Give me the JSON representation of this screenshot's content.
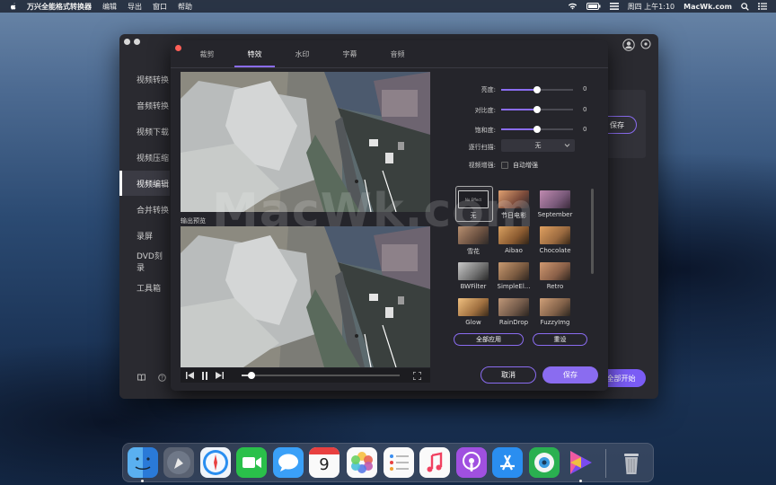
{
  "menubar": {
    "app_name": "万兴全能格式转换器",
    "menus": [
      "编辑",
      "导出",
      "窗口",
      "帮助"
    ],
    "clock": "周四 上午1:10",
    "site": "MacWk.com"
  },
  "sidebar": {
    "items": [
      {
        "label": "视频转换"
      },
      {
        "label": "音频转换"
      },
      {
        "label": "视频下载"
      },
      {
        "label": "视频压缩"
      },
      {
        "label": "视频编辑"
      },
      {
        "label": "合并转换"
      },
      {
        "label": "录屏"
      },
      {
        "label": "DVD刻录"
      },
      {
        "label": "工具箱"
      }
    ]
  },
  "background_window": {
    "save_label": "保存",
    "start_all_label": "全部开始"
  },
  "dialog": {
    "tabs": [
      "裁剪",
      "特效",
      "水印",
      "字幕",
      "音频"
    ],
    "preview_label": "输出预览",
    "adjust": {
      "brightness_label": "亮度:",
      "brightness_value": "0",
      "contrast_label": "对比度:",
      "contrast_value": "0",
      "saturation_label": "饱和度:",
      "saturation_value": "0",
      "deinterlace_label": "逐行扫描:",
      "deinterlace_value": "无",
      "enhance_label": "视频增强:",
      "auto_enhance_label": "自动增强"
    },
    "none_box_text": "No Effect",
    "filters": [
      {
        "name": "无"
      },
      {
        "name": "节日电影"
      },
      {
        "name": "September"
      },
      {
        "name": "雪花"
      },
      {
        "name": "Aibao"
      },
      {
        "name": "Chocolate"
      },
      {
        "name": "BWFilter"
      },
      {
        "name": "SimpleEl..."
      },
      {
        "name": "Retro"
      },
      {
        "name": "Glow"
      },
      {
        "name": "RainDrop"
      },
      {
        "name": "FuzzyImg"
      }
    ],
    "apply_all_label": "全部应用",
    "reset_label": "重设",
    "cancel_label": "取消",
    "save_label": "保存",
    "progress": 0.06
  },
  "watermark_text": "MacWk.com",
  "colors": {
    "accent": "#8a6cf0",
    "panel": "#25252b",
    "sidebar_active": "#3b3b44"
  },
  "dock": {
    "apps": [
      "finder-icon",
      "launchpad-icon",
      "safari-icon",
      "facetime-icon",
      "messages-icon",
      "calendar-icon",
      "photos-icon",
      "reminders-icon",
      "music-icon",
      "podcasts-icon",
      "app-store-icon",
      "camera-app-icon",
      "converter-icon",
      "trash-icon"
    ],
    "calendar_day": "9"
  }
}
